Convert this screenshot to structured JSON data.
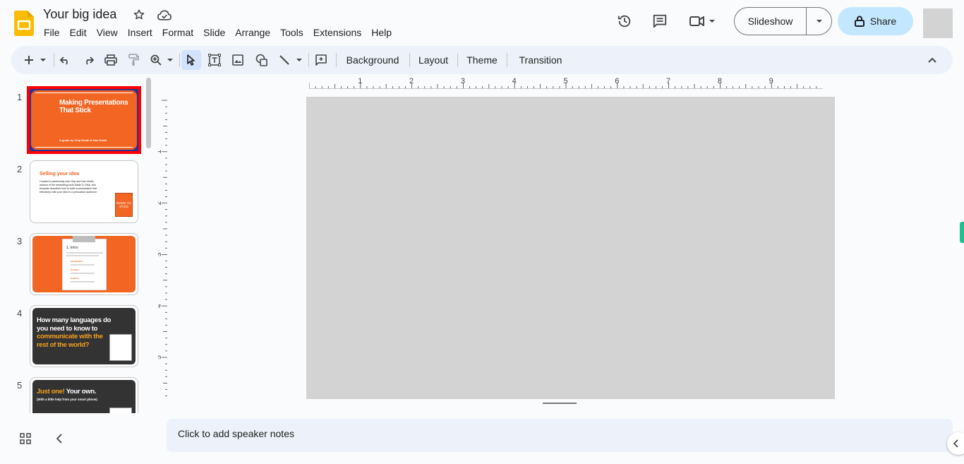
{
  "app": {
    "title": "Your big idea",
    "brand_color": "#fbbc04"
  },
  "menu": [
    "File",
    "Edit",
    "View",
    "Insert",
    "Format",
    "Slide",
    "Arrange",
    "Tools",
    "Extensions",
    "Help"
  ],
  "header": {
    "slideshow_label": "Slideshow",
    "share_label": "Share"
  },
  "toolbar": {
    "background_label": "Background",
    "layout_label": "Layout",
    "theme_label": "Theme",
    "transition_label": "Transition"
  },
  "ruler": {
    "h_labels": [
      "1",
      "2",
      "3",
      "4",
      "5",
      "6",
      "7",
      "8",
      "9"
    ],
    "v_labels": [
      "1",
      "2",
      "3",
      "4",
      "5"
    ]
  },
  "slides": [
    {
      "num": "1",
      "title": "Making Presentations That Stick",
      "subtitle": "A guide by Chip Heath & Dan Heath"
    },
    {
      "num": "2",
      "title": "Selling your idea",
      "body": "Created in partnership with Chip and Dan Heath, authors of the bestselling book Made To Stick, this template describes how to build a presentation that effectively sells your idea to a persuasive audience.",
      "book_label": "MADE TO STICK"
    },
    {
      "num": "3",
      "title": "1. Intro",
      "items": [
        "Introduction",
        "Problem",
        "Solution"
      ]
    },
    {
      "num": "4",
      "line1": "How many languages do you need to know to",
      "line2": "communicate with the rest of the world?"
    },
    {
      "num": "5",
      "accent": "Just one!",
      "rest": "Your own.",
      "sub": "(With a little help from your smart phone)"
    }
  ],
  "notes": {
    "placeholder": "Click to add speaker notes"
  },
  "colors": {
    "orange": "#f26522",
    "dark": "#333333",
    "canvas": "#d3d3d3",
    "accent_gold": "#f6a21e"
  }
}
